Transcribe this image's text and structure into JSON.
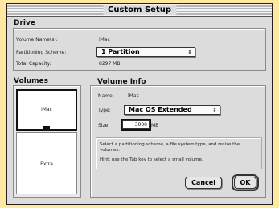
{
  "window": {
    "title": "Custom Setup"
  },
  "drive": {
    "group_title": "Drive",
    "volume_name_label": "Volume Name(s):",
    "volume_name_value": "iMac",
    "partitioning_label": "Partitioning Scheme:",
    "partitioning_value": "1 Partition",
    "capacity_label": "Total Capacity:",
    "capacity_value": "8297 MB"
  },
  "volumes": {
    "group_title": "Volumes",
    "items": [
      {
        "label": "iMac"
      },
      {
        "label": "Extra"
      }
    ]
  },
  "volume_info": {
    "group_title": "Volume Info",
    "name_label": "Name:",
    "name_value": "iMac",
    "type_label": "Type:",
    "type_value": "Mac OS Extended",
    "size_label": "Size:",
    "size_value": "3000",
    "size_unit": "MB"
  },
  "help": {
    "text": "Select a partitioning scheme, a file system type, and resize the volumes.",
    "hint": "Hint: use the Tab key to select a small volume."
  },
  "buttons": {
    "cancel": "Cancel",
    "ok": "OK"
  },
  "icons": {
    "popup_arrow": "updown-arrows-icon"
  }
}
